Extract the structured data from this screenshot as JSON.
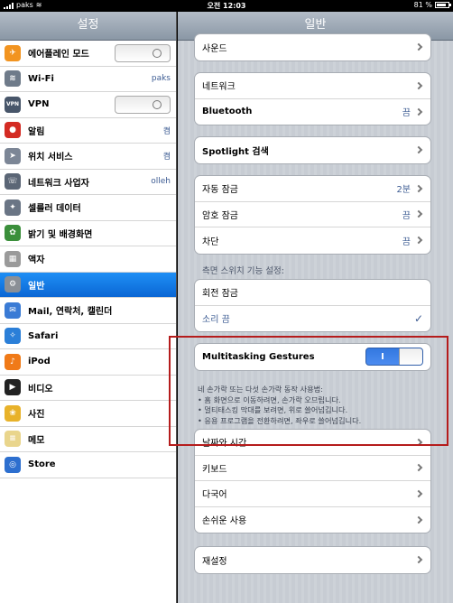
{
  "statusbar": {
    "carrier": "paks",
    "time": "오전 12:03",
    "battery": "81 %",
    "battery_level_pct": 81
  },
  "master": {
    "title": "설정",
    "items": [
      {
        "label": "에어플레인 모드",
        "value": "",
        "icon": "airplane-icon",
        "icon_color": "#f29420",
        "glyph": "✈",
        "toggle": "O"
      },
      {
        "label": "Wi-Fi",
        "value": "paks",
        "icon": "wifi-icon",
        "icon_color": "#6f7b8a",
        "glyph": "≋"
      },
      {
        "label": "VPN",
        "value": "",
        "icon": "vpn-icon",
        "icon_color": "#48566a",
        "glyph": "VPN",
        "toggle": "O"
      },
      {
        "label": "알림",
        "value": "켬",
        "icon": "notifications-icon",
        "icon_color": "#d42b23",
        "glyph": "●"
      },
      {
        "label": "위치 서비스",
        "value": "켬",
        "icon": "location-icon",
        "icon_color": "#7c8696",
        "glyph": "➤"
      },
      {
        "label": "네트워크 사업자",
        "value": "olleh",
        "icon": "carrier-icon",
        "icon_color": "#5b6676",
        "glyph": "☏"
      },
      {
        "label": "셀룰러 데이터",
        "value": "",
        "icon": "cellular-icon",
        "icon_color": "#6a7585",
        "glyph": "✦"
      },
      {
        "label": "밝기 및 배경화면",
        "value": "",
        "icon": "brightness-icon",
        "icon_color": "#3b8f3b",
        "glyph": "✿"
      },
      {
        "label": "액자",
        "value": "",
        "icon": "picture-frame-icon",
        "icon_color": "#9a9a9a",
        "glyph": "▦"
      },
      {
        "label": "일반",
        "value": "",
        "icon": "general-gear-icon",
        "icon_color": "#8a8f96",
        "glyph": "⚙"
      },
      {
        "label": "Mail, 연락처, 캘린더",
        "value": "",
        "icon": "mail-icon",
        "icon_color": "#3a7bd5",
        "glyph": "✉"
      },
      {
        "label": "Safari",
        "value": "",
        "icon": "safari-icon",
        "icon_color": "#2b7fd8",
        "glyph": "✧"
      },
      {
        "label": "iPod",
        "value": "",
        "icon": "ipod-icon",
        "icon_color": "#f07a18",
        "glyph": "♪"
      },
      {
        "label": "비디오",
        "value": "",
        "icon": "video-icon",
        "icon_color": "#222222",
        "glyph": "▶"
      },
      {
        "label": "사진",
        "value": "",
        "icon": "photos-icon",
        "icon_color": "#e8b22a",
        "glyph": "❀"
      },
      {
        "label": "메모",
        "value": "",
        "icon": "notes-icon",
        "icon_color": "#e9d58c",
        "glyph": "≡"
      },
      {
        "label": "Store",
        "value": "",
        "icon": "store-icon",
        "icon_color": "#2d6fcf",
        "glyph": "◎"
      }
    ]
  },
  "detail": {
    "title": "일반",
    "rows": {
      "sound": {
        "label": "사운드"
      },
      "network": {
        "label": "네트워크"
      },
      "bluetooth": {
        "label": "Bluetooth",
        "value": "끔"
      },
      "spotlight": {
        "label": "Spotlight 검색"
      },
      "auto_lock": {
        "label": "자동 잠금",
        "value": "2분"
      },
      "passcode_lock": {
        "label": "암호 잠금",
        "value": "끔"
      },
      "restrictions": {
        "label": "차단",
        "value": "끔"
      }
    },
    "side_switch": {
      "section_title": "측면 스위치 기능 설정:",
      "rotation_lock": "회전 잠금",
      "mute": "소리 끔"
    },
    "multitasking": {
      "label": "Multitasking Gestures",
      "toggle": "I",
      "description": [
        "네 손가락 또는 다섯 손가락 동작 사용법:",
        "• 홈 화면으로 이동하려면, 손가락 오므립니다.",
        "• 멀티태스킹 막대를 보려면, 위로 쓸어넘깁니다.",
        "• 응용 프로그램을 전환하려면, 좌우로 쓸어넘깁니다."
      ]
    },
    "bottom_rows": {
      "date_time": "날짜와 시간",
      "keyboard": "키보드",
      "language": "다국어",
      "accessibility": "손쉬운 사용"
    },
    "reset": "재설정"
  }
}
